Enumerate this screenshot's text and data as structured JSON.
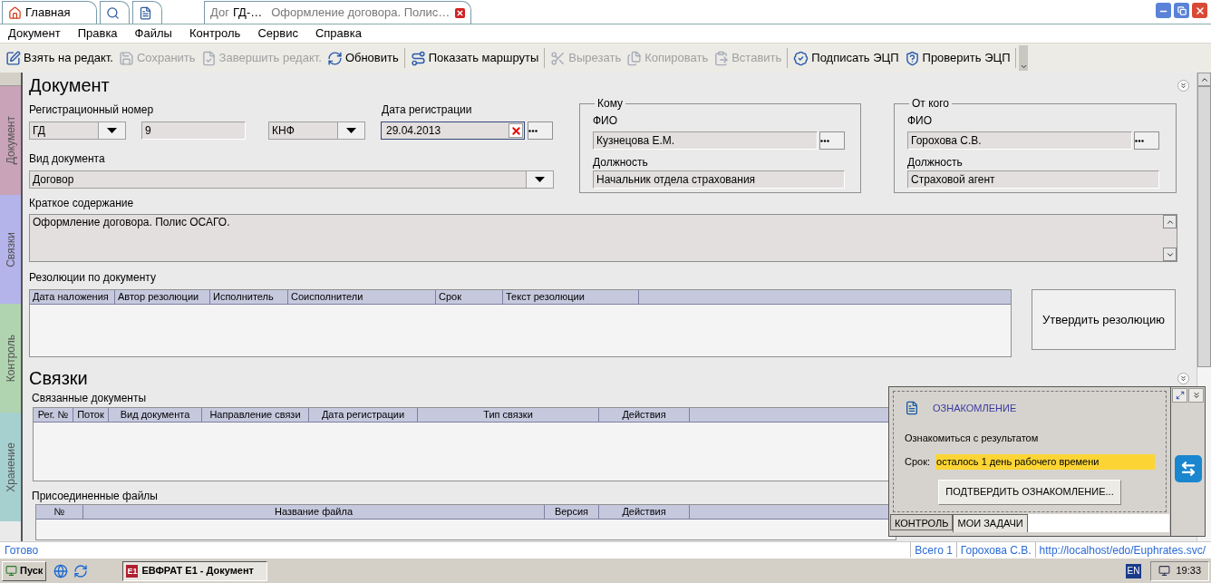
{
  "app_tabs": [
    {
      "kind": "home",
      "label": "Главная"
    },
    {
      "kind": "search"
    },
    {
      "kind": "note"
    },
    {
      "kind": "document",
      "prefix": "Дог",
      "number": "ГД-…",
      "title": "Оформление договора. Полис…"
    }
  ],
  "menu": [
    "Документ",
    "Правка",
    "Файлы",
    "Контроль",
    "Сервис",
    "Справка"
  ],
  "toolbar": [
    [
      {
        "kind": "edit",
        "label": "Взять на редакт.",
        "disabled": false
      },
      {
        "kind": "save",
        "label": "Сохранить",
        "disabled": true
      },
      {
        "kind": "finish",
        "label": "Завершить редакт.",
        "disabled": true
      },
      {
        "kind": "refresh",
        "label": "Обновить",
        "disabled": false
      }
    ],
    [
      {
        "kind": "routes",
        "label": "Показать маршруты",
        "disabled": false
      }
    ],
    [
      {
        "kind": "cut",
        "label": "Вырезать",
        "disabled": true
      },
      {
        "kind": "copy",
        "label": "Копировать",
        "disabled": true
      },
      {
        "kind": "paste",
        "label": "Вставить",
        "disabled": true
      }
    ],
    [
      {
        "kind": "sign",
        "label": "Подписать ЭЦП",
        "disabled": false
      },
      {
        "kind": "verify",
        "label": "Проверить ЭЦП",
        "disabled": false
      }
    ]
  ],
  "side_tabs": [
    {
      "label": "Документ",
      "color": "#c9a3b8"
    },
    {
      "label": "Связки",
      "color": "#b4b4ea"
    },
    {
      "label": "Контроль",
      "color": "#b0d4b0"
    },
    {
      "label": "Хранение",
      "color": "#a6d0d0"
    }
  ],
  "document": {
    "title": "Документ",
    "reg_number_label": "Регистрационный номер",
    "prefix": "ГД",
    "number": "9",
    "suffix": "КНФ",
    "reg_date_label": "Дата регистрации",
    "reg_date": "29.04.2013",
    "doc_type_label": "Вид документа",
    "doc_type": "Договор",
    "to": {
      "legend": "Кому",
      "name_label": "ФИО",
      "name": "Кузнецова Е.М.",
      "position_label": "Должность",
      "position": "Начальник отдела страхования"
    },
    "from": {
      "legend": "От кого",
      "name_label": "ФИО",
      "name": "Горохова С.В.",
      "position_label": "Должность",
      "position": "Страховой агент"
    },
    "summary_label": "Краткое содержание",
    "summary": "Оформление договора. Полис ОСАГО.",
    "resolutions_label": "Резолюции по документу",
    "resolutions_columns": [
      "Дата наложения",
      "Автор резолюции",
      "Исполнитель",
      "Соисполнители",
      "Срок",
      "Текст резолюции"
    ],
    "approve_button": "Утвердить резолюцию"
  },
  "links": {
    "title": "Связки",
    "linked_label": "Связанные документы",
    "linked_columns": [
      "Рег. №",
      "Поток",
      "Вид документа",
      "Направление связи",
      "Дата регистрации",
      "Тип связки",
      "Действия"
    ],
    "files_label": "Присоединенные файлы",
    "files_columns": [
      "№",
      "Название файла",
      "Версия",
      "Действия"
    ]
  },
  "task_panel": {
    "title": "ОЗНАКОМЛЕНИЕ",
    "text": "Ознакомиться с результатом",
    "deadline_label": "Срок:",
    "deadline": "осталось 1 день рабочего времени",
    "button": "ПОДТВЕРДИТЬ ОЗНАКОМЛЕНИЕ...",
    "tabs": [
      {
        "label": "КОНТРОЛЬ",
        "selected": false
      },
      {
        "label": "МОИ ЗАДАЧИ",
        "selected": true
      }
    ]
  },
  "status_bar": {
    "status": "Готово",
    "count": "Всего 1",
    "user": "Горохова С.В.",
    "url": "http://localhost/edo/Euphrates.svc/"
  },
  "taskbar": {
    "start": "Пуск",
    "window_icon": "E1",
    "window": "ЕВФРАТ Е1 - Документ",
    "language": "EN",
    "clock": "19:33"
  }
}
